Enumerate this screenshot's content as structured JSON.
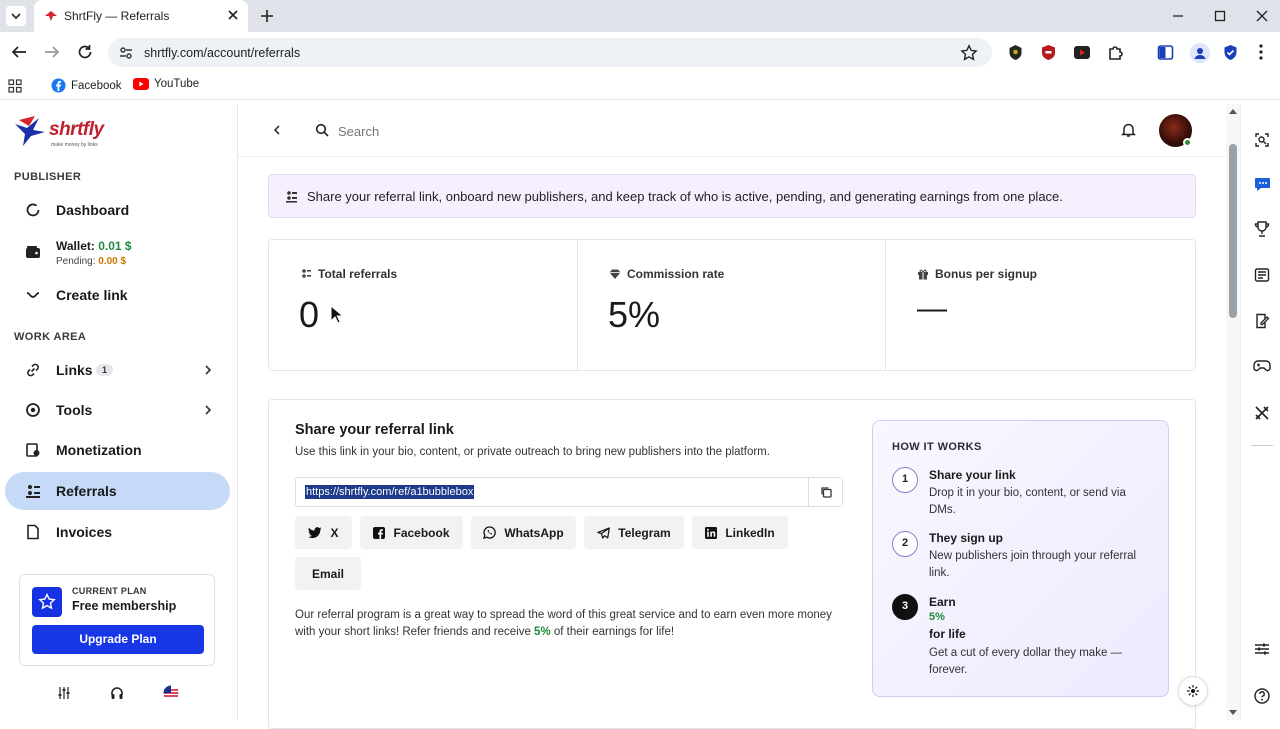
{
  "browser": {
    "tab_title": "ShrtFly — Referrals",
    "url": "shrtfly.com/account/referrals",
    "bookmarks": [
      {
        "label": "Facebook",
        "icon": "facebook-icon"
      },
      {
        "label": "YouTube",
        "icon": "youtube-icon"
      }
    ]
  },
  "sidebar": {
    "logo_text": "shrtfly",
    "logo_tagline": "make money by links",
    "section_publisher": "PUBLISHER",
    "dashboard": "Dashboard",
    "wallet_label": "Wallet:",
    "wallet_value": "0.01 $",
    "pending_label": "Pending:",
    "pending_value": "0.00 $",
    "create_link": "Create link",
    "section_work": "WORK AREA",
    "links": "Links",
    "links_badge": "1",
    "tools": "Tools",
    "monetization": "Monetization",
    "referrals": "Referrals",
    "invoices": "Invoices",
    "plan_kicker": "CURRENT PLAN",
    "plan_name": "Free membership",
    "upgrade": "Upgrade Plan"
  },
  "topbar": {
    "search_placeholder": "Search"
  },
  "info_banner": "Share your referral link, onboard new publishers, and keep track of who is active, pending, and generating earnings from one place.",
  "stats": [
    {
      "label": "Total referrals",
      "value": "0",
      "icon": "users-icon"
    },
    {
      "label": "Commission rate",
      "value": "5%",
      "icon": "diamond-icon"
    },
    {
      "label": "Bonus per signup",
      "value": "—",
      "icon": "gift-icon"
    }
  ],
  "share": {
    "title": "Share your referral link",
    "subtitle": "Use this link in your bio, content, or private outreach to bring new publishers into the platform.",
    "link": "https://shrtfly.com/ref/a1bubblebox",
    "buttons": [
      "X",
      "Facebook",
      "WhatsApp",
      "Telegram",
      "LinkedIn",
      "Email"
    ],
    "desc_before": "Our referral program is a great way to spread the word of this great service and to earn even more money with your short links! Refer friends and receive ",
    "desc_rate": "5%",
    "desc_after": " of their earnings for life!"
  },
  "how_it_works": {
    "title": "HOW IT WORKS",
    "steps": [
      {
        "num": "1",
        "title": "Share your link",
        "desc": "Drop it in your bio, content, or send via DMs."
      },
      {
        "num": "2",
        "title": "They sign up",
        "desc": "New publishers join through your referral link."
      },
      {
        "num": "3",
        "title": "Earn",
        "rate": "5%",
        "title_suffix": "for life",
        "desc": "Get a cut of every dollar they make — forever."
      }
    ]
  },
  "colors": {
    "accent_blue": "#1736e6",
    "active_nav": "#c6d9f7",
    "wallet_green": "#1f8a3b",
    "pending_orange": "#c77700",
    "banner_bg": "#f6f0fe"
  }
}
